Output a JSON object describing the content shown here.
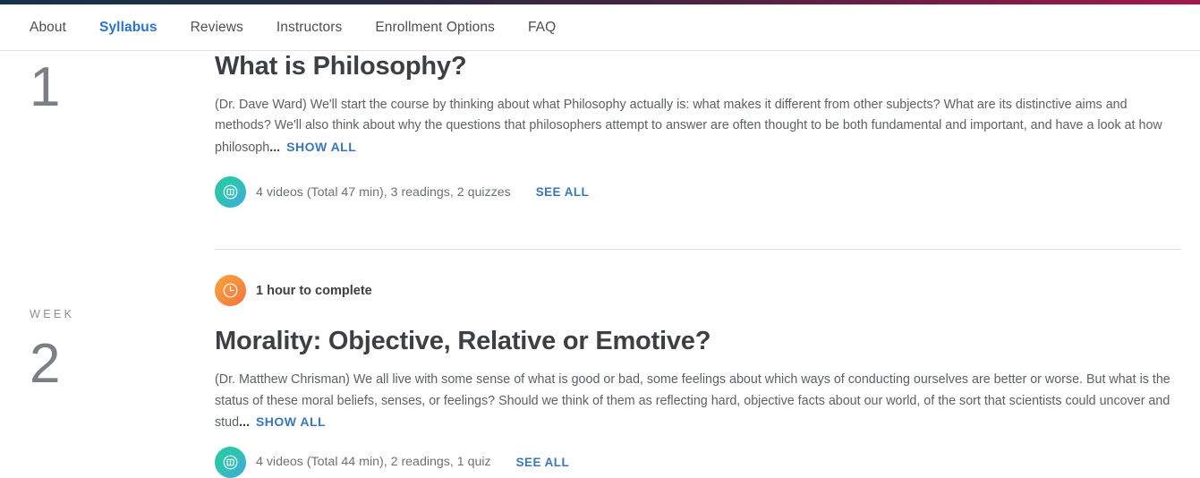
{
  "topbar": {
    "gradient_start": "#16324a",
    "gradient_end": "#a4184f"
  },
  "nav": {
    "items": [
      {
        "label": "About",
        "active": false
      },
      {
        "label": "Syllabus",
        "active": true
      },
      {
        "label": "Reviews",
        "active": false
      },
      {
        "label": "Instructors",
        "active": false
      },
      {
        "label": "Enrollment Options",
        "active": false
      },
      {
        "label": "FAQ",
        "active": false
      }
    ],
    "active_color": "#2a73cc"
  },
  "weeks": [
    {
      "week_label": "",
      "week_number": "1",
      "title": "What is Philosophy?",
      "description": "(Dr. Dave Ward) We'll start the course by thinking about what Philosophy actually is: what makes it different from other subjects? What are its distinctive aims and methods? We'll also think about why the questions that philosophers attempt to answer are often thought to be both fundamental and important, and have a look at how philosoph",
      "ellipsis": "...",
      "show_all_label": "SHOW ALL",
      "duration": null,
      "content_icon": "module-book-icon",
      "content_summary": "4 videos (Total 47 min), 3 readings, 2 quizzes",
      "see_all_label": "SEE ALL"
    },
    {
      "week_label": "WEEK",
      "week_number": "2",
      "duration_icon": "clock-icon",
      "duration": "1 hour to complete",
      "title": "Morality: Objective, Relative or Emotive?",
      "description": "(Dr. Matthew Chrisman) We all live with some sense of what is good or bad, some feelings about which ways of conducting ourselves are better or worse. But what is the status of these moral beliefs, senses, or feelings? Should we think of them as reflecting hard, objective facts about our world, of the sort that scientists could uncover and stud",
      "ellipsis": "...",
      "show_all_label": "SHOW ALL",
      "content_icon": "module-book-icon",
      "content_summary": "4 videos (Total 44 min), 2 readings, 1 quiz",
      "see_all_label": "SEE ALL"
    }
  ],
  "colors": {
    "link": "#3a76b8",
    "heading": "#3c4043",
    "body_text": "#5c6164",
    "teal_icon": "#2ec4b0",
    "orange_icon": "#f7903d",
    "divider": "#e3e3e3"
  }
}
